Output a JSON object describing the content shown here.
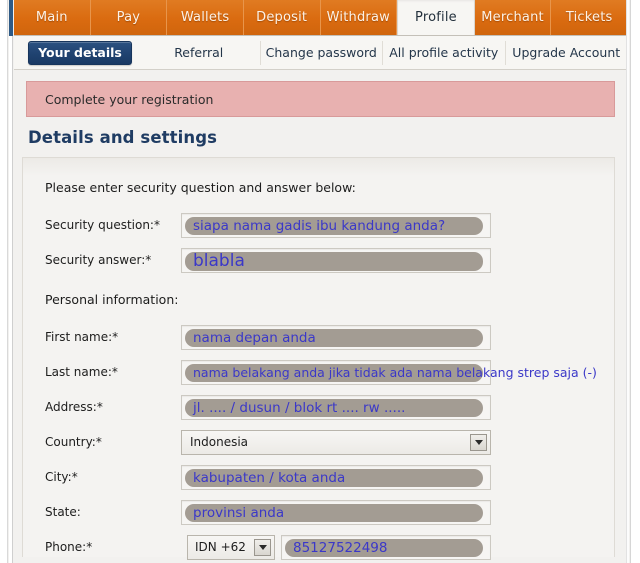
{
  "main_tabs": [
    {
      "label": "Main",
      "active": false
    },
    {
      "label": "Pay",
      "active": false
    },
    {
      "label": "Wallets",
      "active": false
    },
    {
      "label": "Deposit",
      "active": false
    },
    {
      "label": "Withdraw",
      "active": false
    },
    {
      "label": "Profile",
      "active": true
    },
    {
      "label": "Merchant",
      "active": false
    },
    {
      "label": "Tickets",
      "active": false
    }
  ],
  "sub_tabs": [
    {
      "label": "Your details",
      "active": true
    },
    {
      "label": "Referral",
      "active": false
    },
    {
      "label": "Change password",
      "active": false
    },
    {
      "label": "All profile activity",
      "active": false
    },
    {
      "label": "Upgrade Account",
      "active": false
    }
  ],
  "alert": {
    "message": "Complete your registration"
  },
  "page_heading": "Details and settings",
  "security_section": {
    "label": "Please enter security question and answer below:",
    "question": {
      "label": "Security question:*",
      "value": "siapa nama gadis ibu kandung anda?"
    },
    "answer": {
      "label": "Security answer:*",
      "value": "blabla"
    }
  },
  "personal_section": {
    "label": "Personal information:",
    "first_name": {
      "label": "First name:*",
      "value": "nama depan anda"
    },
    "last_name": {
      "label": "Last name:*",
      "value": "nama belakang anda jika tidak ada nama belakang strep saja (-)"
    },
    "address": {
      "label": "Address:*",
      "value": "jl. .... / dusun / blok rt .... rw ....."
    },
    "country": {
      "label": "Country:*",
      "value": "Indonesia"
    },
    "city": {
      "label": "City:*",
      "value": "kabupaten / kota anda"
    },
    "state": {
      "label": "State:",
      "value": "provinsi anda"
    },
    "phone": {
      "label": "Phone:*",
      "code_value": "IDN +62",
      "number_value": "85127522498"
    }
  },
  "colors": {
    "tab_orange": "#da6b10",
    "active_subtab_blue": "#1f4270",
    "alert_pink": "#e8b1b0",
    "heading_blue": "#1f3c63",
    "input_text_blue": "#3b38c8",
    "pill_grey": "#a39c93"
  }
}
